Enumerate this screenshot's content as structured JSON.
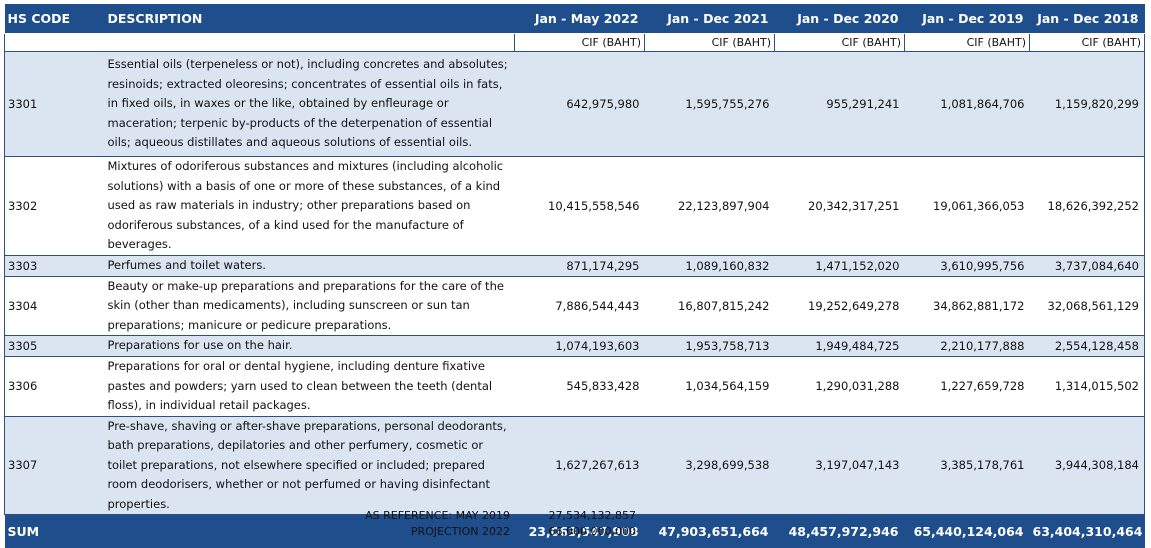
{
  "header": {
    "hs_code": "HS CODE",
    "description": "DESCRIPTION",
    "periods": [
      "Jan - May 2022",
      "Jan - Dec 2021",
      "Jan - Dec 2020",
      "Jan - Dec 2019",
      "Jan - Dec 2018"
    ]
  },
  "units": [
    "CIF (BAHT)",
    "CIF (BAHT)",
    "CIF (BAHT)",
    "CIF (BAHT)",
    "CIF (BAHT)"
  ],
  "rows": [
    {
      "code": "3301",
      "description": "Essential oils (terpeneless or not), including concretes and absolutes; resinoids; extracted oleoresins; concentrates of essential oils in fats, in fixed oils, in waxes or the like, obtained by enfleurage or maceration; terpenic by-products of the deterpenation of essential oils; aqueous distillates and aqueous solutions of essential oils.",
      "values": [
        "642,975,980",
        "1,595,755,276",
        "955,291,241",
        "1,081,864,706",
        "1,159,820,299"
      ]
    },
    {
      "code": "3302",
      "description": "Mixtures of odoriferous substances and mixtures (including alcoholic solutions) with a basis of one or more of these substances, of a kind used as raw materials in industry; other preparations based on odoriferous substances, of a kind used for the manufacture of beverages.",
      "values": [
        "10,415,558,546",
        "22,123,897,904",
        "20,342,317,251",
        "19,061,366,053",
        "18,626,392,252"
      ]
    },
    {
      "code": "3303",
      "description": "Perfumes and toilet waters.",
      "values": [
        "871,174,295",
        "1,089,160,832",
        "1,471,152,020",
        "3,610,995,756",
        "3,737,084,640"
      ]
    },
    {
      "code": "3304",
      "description": "Beauty or make-up preparations and preparations for the care of the skin (other than medicaments), including sunscreen or sun tan preparations; manicure or pedicure preparations.",
      "values": [
        "7,886,544,443",
        "16,807,815,242",
        "19,252,649,278",
        "34,862,881,172",
        "32,068,561,129"
      ]
    },
    {
      "code": "3305",
      "description": "Preparations for use on the hair.",
      "values": [
        "1,074,193,603",
        "1,953,758,713",
        "1,949,484,725",
        "2,210,177,888",
        "2,554,128,458"
      ]
    },
    {
      "code": "3306",
      "description": "Preparations for oral or dental hygiene, including denture fixative pastes and powders; yarn used to clean between the teeth (dental floss), in individual retail packages.",
      "values": [
        "545,833,428",
        "1,034,564,159",
        "1,290,031,288",
        "1,227,659,728",
        "1,314,015,502"
      ]
    },
    {
      "code": "3307",
      "description": "Pre-shave, shaving or after-shave preparations, personal deodorants, bath preparations, depilatories and other perfumery, cosmetic or toilet preparations, not elsewhere specified or included; prepared room deodorisers, whether or not perfumed or having disinfectant properties.",
      "values": [
        "1,627,267,613",
        "3,298,699,538",
        "3,197,047,143",
        "3,385,178,761",
        "3,944,308,184"
      ]
    }
  ],
  "sum": {
    "label": "SUM",
    "values": [
      "23,063,547,908",
      "47,903,651,664",
      "48,457,972,946",
      "65,440,124,064",
      "63,404,310,464"
    ]
  },
  "references": [
    {
      "label": "AS REFERENCE: MAY 2019",
      "value": "27,534,132,857"
    },
    {
      "label": "PROJECTION 2022",
      "value": "66,000,000,000"
    }
  ]
}
